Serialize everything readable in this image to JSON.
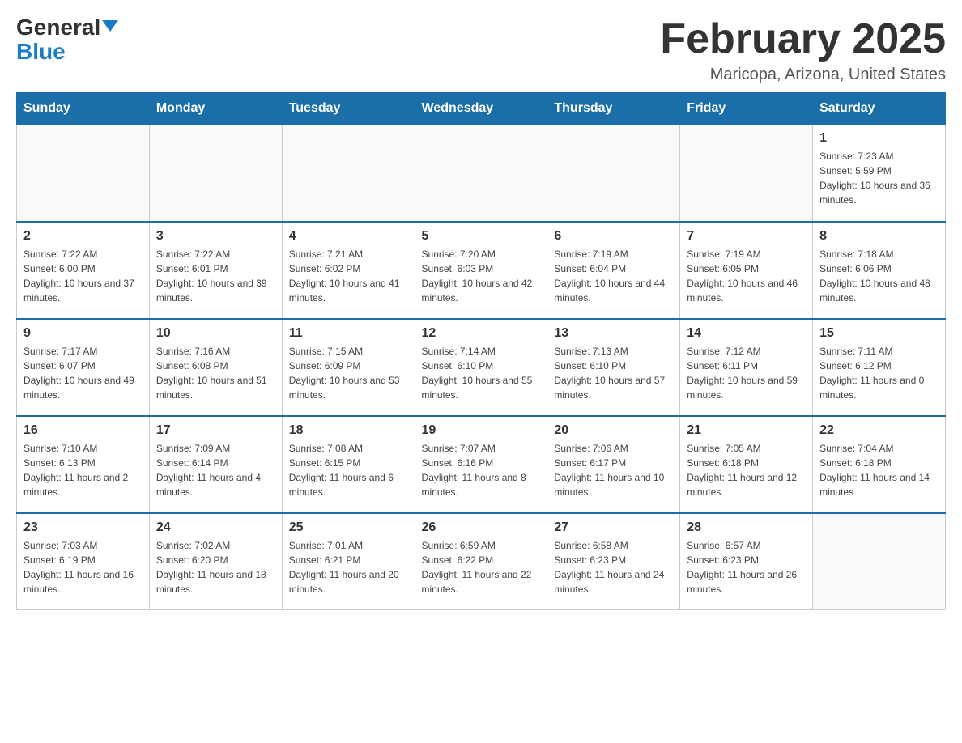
{
  "header": {
    "logo_line1": "General",
    "logo_line2": "Blue",
    "month_title": "February 2025",
    "location": "Maricopa, Arizona, United States"
  },
  "days_of_week": [
    "Sunday",
    "Monday",
    "Tuesday",
    "Wednesday",
    "Thursday",
    "Friday",
    "Saturday"
  ],
  "weeks": [
    [
      {
        "day": "",
        "info": ""
      },
      {
        "day": "",
        "info": ""
      },
      {
        "day": "",
        "info": ""
      },
      {
        "day": "",
        "info": ""
      },
      {
        "day": "",
        "info": ""
      },
      {
        "day": "",
        "info": ""
      },
      {
        "day": "1",
        "info": "Sunrise: 7:23 AM\nSunset: 5:59 PM\nDaylight: 10 hours and 36 minutes."
      }
    ],
    [
      {
        "day": "2",
        "info": "Sunrise: 7:22 AM\nSunset: 6:00 PM\nDaylight: 10 hours and 37 minutes."
      },
      {
        "day": "3",
        "info": "Sunrise: 7:22 AM\nSunset: 6:01 PM\nDaylight: 10 hours and 39 minutes."
      },
      {
        "day": "4",
        "info": "Sunrise: 7:21 AM\nSunset: 6:02 PM\nDaylight: 10 hours and 41 minutes."
      },
      {
        "day": "5",
        "info": "Sunrise: 7:20 AM\nSunset: 6:03 PM\nDaylight: 10 hours and 42 minutes."
      },
      {
        "day": "6",
        "info": "Sunrise: 7:19 AM\nSunset: 6:04 PM\nDaylight: 10 hours and 44 minutes."
      },
      {
        "day": "7",
        "info": "Sunrise: 7:19 AM\nSunset: 6:05 PM\nDaylight: 10 hours and 46 minutes."
      },
      {
        "day": "8",
        "info": "Sunrise: 7:18 AM\nSunset: 6:06 PM\nDaylight: 10 hours and 48 minutes."
      }
    ],
    [
      {
        "day": "9",
        "info": "Sunrise: 7:17 AM\nSunset: 6:07 PM\nDaylight: 10 hours and 49 minutes."
      },
      {
        "day": "10",
        "info": "Sunrise: 7:16 AM\nSunset: 6:08 PM\nDaylight: 10 hours and 51 minutes."
      },
      {
        "day": "11",
        "info": "Sunrise: 7:15 AM\nSunset: 6:09 PM\nDaylight: 10 hours and 53 minutes."
      },
      {
        "day": "12",
        "info": "Sunrise: 7:14 AM\nSunset: 6:10 PM\nDaylight: 10 hours and 55 minutes."
      },
      {
        "day": "13",
        "info": "Sunrise: 7:13 AM\nSunset: 6:10 PM\nDaylight: 10 hours and 57 minutes."
      },
      {
        "day": "14",
        "info": "Sunrise: 7:12 AM\nSunset: 6:11 PM\nDaylight: 10 hours and 59 minutes."
      },
      {
        "day": "15",
        "info": "Sunrise: 7:11 AM\nSunset: 6:12 PM\nDaylight: 11 hours and 0 minutes."
      }
    ],
    [
      {
        "day": "16",
        "info": "Sunrise: 7:10 AM\nSunset: 6:13 PM\nDaylight: 11 hours and 2 minutes."
      },
      {
        "day": "17",
        "info": "Sunrise: 7:09 AM\nSunset: 6:14 PM\nDaylight: 11 hours and 4 minutes."
      },
      {
        "day": "18",
        "info": "Sunrise: 7:08 AM\nSunset: 6:15 PM\nDaylight: 11 hours and 6 minutes."
      },
      {
        "day": "19",
        "info": "Sunrise: 7:07 AM\nSunset: 6:16 PM\nDaylight: 11 hours and 8 minutes."
      },
      {
        "day": "20",
        "info": "Sunrise: 7:06 AM\nSunset: 6:17 PM\nDaylight: 11 hours and 10 minutes."
      },
      {
        "day": "21",
        "info": "Sunrise: 7:05 AM\nSunset: 6:18 PM\nDaylight: 11 hours and 12 minutes."
      },
      {
        "day": "22",
        "info": "Sunrise: 7:04 AM\nSunset: 6:18 PM\nDaylight: 11 hours and 14 minutes."
      }
    ],
    [
      {
        "day": "23",
        "info": "Sunrise: 7:03 AM\nSunset: 6:19 PM\nDaylight: 11 hours and 16 minutes."
      },
      {
        "day": "24",
        "info": "Sunrise: 7:02 AM\nSunset: 6:20 PM\nDaylight: 11 hours and 18 minutes."
      },
      {
        "day": "25",
        "info": "Sunrise: 7:01 AM\nSunset: 6:21 PM\nDaylight: 11 hours and 20 minutes."
      },
      {
        "day": "26",
        "info": "Sunrise: 6:59 AM\nSunset: 6:22 PM\nDaylight: 11 hours and 22 minutes."
      },
      {
        "day": "27",
        "info": "Sunrise: 6:58 AM\nSunset: 6:23 PM\nDaylight: 11 hours and 24 minutes."
      },
      {
        "day": "28",
        "info": "Sunrise: 6:57 AM\nSunset: 6:23 PM\nDaylight: 11 hours and 26 minutes."
      },
      {
        "day": "",
        "info": ""
      }
    ]
  ]
}
